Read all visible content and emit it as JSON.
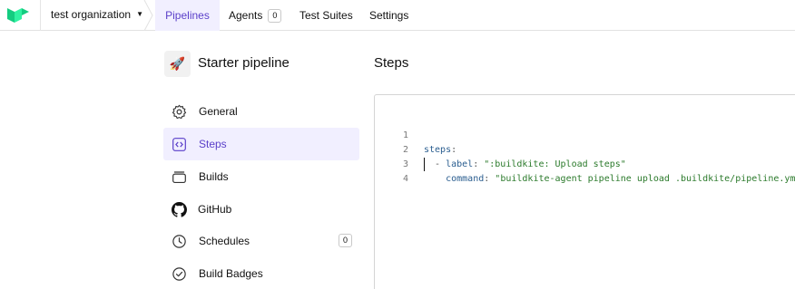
{
  "topnav": {
    "org_name": "test organization",
    "tabs": [
      {
        "label": "Pipelines",
        "active": true
      },
      {
        "label": "Agents",
        "badge": "0"
      },
      {
        "label": "Test Suites"
      },
      {
        "label": "Settings"
      }
    ]
  },
  "pipeline": {
    "icon": "🚀",
    "name": "Starter pipeline"
  },
  "sidebar": {
    "items": [
      {
        "label": "General",
        "icon": "gear-icon"
      },
      {
        "label": "Steps",
        "icon": "code-brackets-icon",
        "active": true
      },
      {
        "label": "Builds",
        "icon": "builds-stack-icon"
      },
      {
        "label": "GitHub",
        "icon": "github-icon"
      },
      {
        "label": "Schedules",
        "icon": "clock-icon",
        "badge": "0"
      },
      {
        "label": "Build Badges",
        "icon": "check-badge-icon"
      }
    ]
  },
  "main": {
    "heading": "Steps",
    "editor": {
      "lines": [
        {
          "num": "1",
          "key": "steps",
          "after_key": ":"
        },
        {
          "num": "2",
          "prefix": "  - ",
          "key": "label",
          "after_key": ": ",
          "value": "\":buildkite: Upload steps\""
        },
        {
          "num": "3",
          "prefix": "    ",
          "key": "command",
          "after_key": ": ",
          "value": "\"buildkite-agent pipeline upload .buildkite/pipeline.yml\""
        },
        {
          "num": "4"
        }
      ]
    }
  },
  "colors": {
    "accent": "#5a3fc9",
    "active_bg": "#f1efff",
    "brand_green": "#14cc80",
    "yaml_key": "#2a5d8f",
    "yaml_string": "#2b7a2b"
  }
}
